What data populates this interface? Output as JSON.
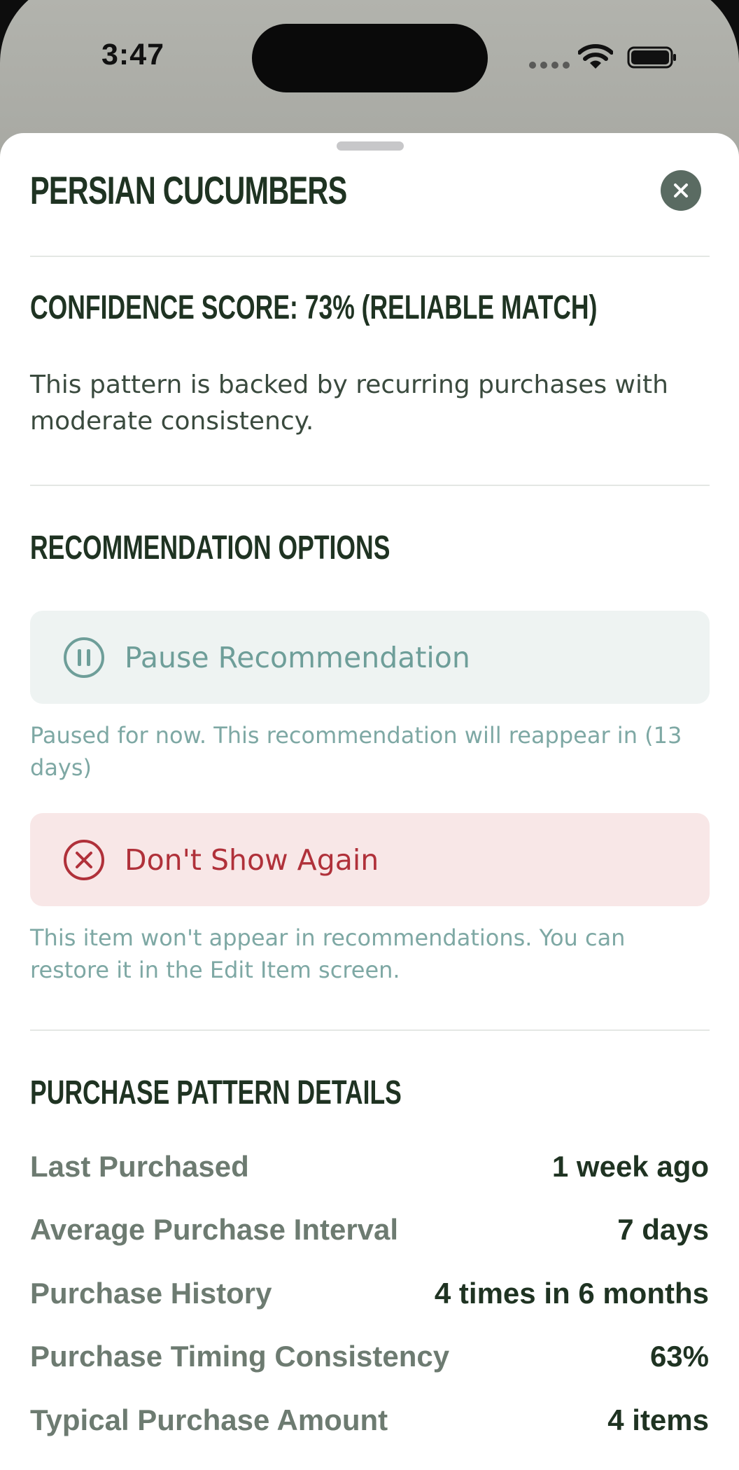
{
  "status_bar": {
    "time": "3:47",
    "icons": [
      "signal-dots-icon",
      "wifi-icon",
      "battery-icon"
    ]
  },
  "sheet": {
    "title": "PERSIAN CUCUMBERS",
    "close_icon": "close-icon",
    "confidence": {
      "heading": "CONFIDENCE SCORE: 73% (RELIABLE MATCH)",
      "description": "This pattern is backed by recurring purchases with moderate consistency."
    },
    "options": {
      "heading": "RECOMMENDATION OPTIONS",
      "pause": {
        "icon": "pause-circle-icon",
        "label": "Pause Recommendation",
        "note": "Paused for now. This recommendation will reappear in (13 days)"
      },
      "dont_show": {
        "icon": "x-circle-icon",
        "label": "Don't Show Again",
        "note": "This item won't appear in recommendations. You can restore it in the Edit Item screen."
      }
    },
    "details": {
      "heading": "PURCHASE PATTERN DETAILS",
      "rows": [
        {
          "label": "Last Purchased",
          "value": "1 week ago"
        },
        {
          "label": "Average Purchase Interval",
          "value": "7 days"
        },
        {
          "label": "Purchase History",
          "value": "4 times in 6 months"
        },
        {
          "label": "Purchase Timing Consistency",
          "value": "63%"
        },
        {
          "label": "Typical Purchase Amount",
          "value": "4 items"
        }
      ]
    }
  },
  "colors": {
    "heading": "#1f3322",
    "pause_accent": "#6e9e99",
    "dont_show_accent": "#b0313a",
    "close_button": "#5a6b62"
  }
}
